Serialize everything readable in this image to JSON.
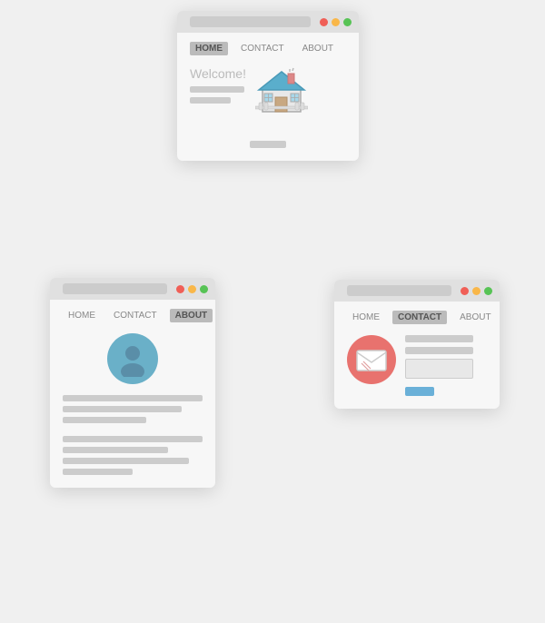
{
  "window1": {
    "nav": {
      "home": "HOME",
      "contact": "CONTACT",
      "about": "ABOUT",
      "active": "home"
    },
    "welcome": "Welcome!",
    "bottom_bar_width": 40
  },
  "window2": {
    "nav": {
      "home": "HOME",
      "contact": "CONTACT",
      "about": "ABOUT",
      "active": "about"
    }
  },
  "window3": {
    "nav": {
      "home": "HOME",
      "contact": "CONTACT",
      "about": "ABOUT",
      "active": "contact"
    }
  }
}
